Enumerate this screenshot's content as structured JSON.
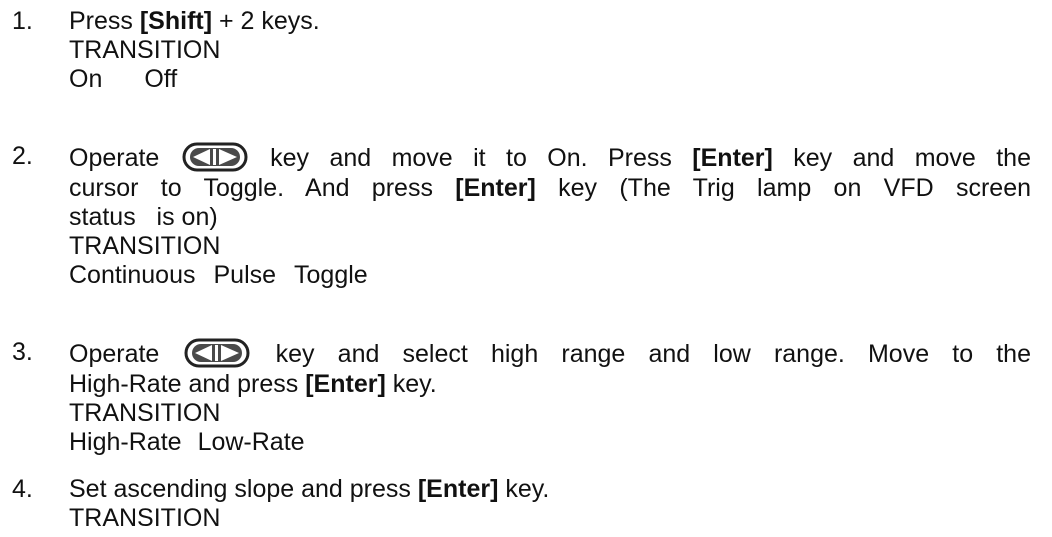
{
  "steps": [
    {
      "num": "1.",
      "text_a": "Press ",
      "bold_a": "[Shift]",
      "text_b": " + 2 keys.",
      "mode": "TRANSITION",
      "options": [
        "On",
        "Off"
      ]
    },
    {
      "num": "2.",
      "lead": "Operate",
      "after_icon": "key and move it to On. Press ",
      "bold_a": "[Enter]",
      "after_bold_a": " key and move the",
      "line2_a": "cursor to Toggle. And press ",
      "bold_b": "[Enter]",
      "line2_b": " key (The Trig lamp on VFD screen",
      "line3": "status   is on)",
      "mode": "TRANSITION",
      "options": [
        "Continuous",
        "Pulse",
        "Toggle"
      ]
    },
    {
      "num": "3.",
      "lead": "Operate",
      "after_icon": "key and select high range and low range. Move to the",
      "line2_a": "High-Rate and press ",
      "bold_a": "[Enter]",
      "line2_b": " key.",
      "mode": "TRANSITION",
      "options": [
        "High-Rate",
        "Low-Rate"
      ]
    },
    {
      "num": "4.",
      "text_a": "Set ascending slope and press ",
      "bold_a": "[Enter]",
      "text_b": " key.",
      "mode": "TRANSITION"
    }
  ],
  "icons": {
    "left_right_key": "left-right-arrow-key-icon"
  }
}
